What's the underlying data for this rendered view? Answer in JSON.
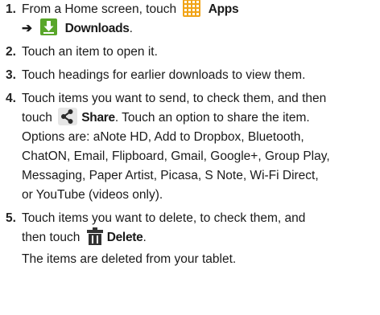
{
  "steps": [
    {
      "number": "1.",
      "part1": "From a Home screen, touch",
      "apps_label": "Apps",
      "arrow": "➔",
      "downloads_label": "Downloads",
      "downloads_suffix": "."
    },
    {
      "number": "2.",
      "text": "Touch an item to open it."
    },
    {
      "number": "3.",
      "text": "Touch headings for earlier downloads to view them."
    },
    {
      "number": "4.",
      "line1": "Touch items you want to send, to check them, and then",
      "line2_prefix": "touch",
      "share_label": "Share",
      "line2_suffix": ". Touch an option to share the item.",
      "line3": "Options are: aNote HD, Add to Dropbox, Bluetooth,",
      "line4": "ChatON, Email, Flipboard, Gmail, Google+, Group Play,",
      "line5": "Messaging, Paper Artist, Picasa, S Note, Wi-Fi Direct,",
      "line6": "or YouTube (videos only)."
    },
    {
      "number": "5.",
      "line1": "Touch items you want to delete, to check them, and",
      "line2_prefix": "then touch",
      "delete_label": "Delete",
      "line2_suffix": ".",
      "note": "The items are deleted from your tablet."
    }
  ],
  "icons": {
    "apps": "apps-grid-icon",
    "downloads": "download-arrow-icon",
    "share": "share-icon",
    "delete": "trash-icon"
  },
  "colors": {
    "apps_icon": "#f1a418",
    "downloads_icon": "#59a62a",
    "delete_icon": "#333333"
  }
}
